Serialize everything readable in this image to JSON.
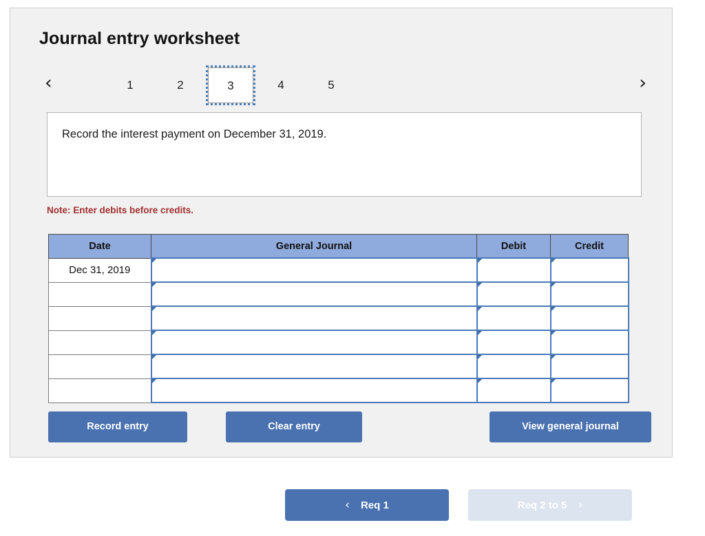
{
  "worksheet": {
    "title": "Journal entry worksheet",
    "prev_icon": "chevron-left-icon",
    "next_icon": "chevron-right-icon",
    "tabs": [
      {
        "label": "1",
        "active": false
      },
      {
        "label": "2",
        "active": false
      },
      {
        "label": "3",
        "active": true
      },
      {
        "label": "4",
        "active": false
      },
      {
        "label": "5",
        "active": false
      }
    ],
    "description": "Record the interest payment on December 31, 2019.",
    "note": "Note: Enter debits before credits."
  },
  "journal": {
    "headers": {
      "date": "Date",
      "general_journal": "General Journal",
      "debit": "Debit",
      "credit": "Credit"
    },
    "rows": [
      {
        "date": "Dec 31, 2019",
        "general_journal": "",
        "debit": "",
        "credit": ""
      },
      {
        "date": "",
        "general_journal": "",
        "debit": "",
        "credit": ""
      },
      {
        "date": "",
        "general_journal": "",
        "debit": "",
        "credit": ""
      },
      {
        "date": "",
        "general_journal": "",
        "debit": "",
        "credit": ""
      },
      {
        "date": "",
        "general_journal": "",
        "debit": "",
        "credit": ""
      },
      {
        "date": "",
        "general_journal": "",
        "debit": "",
        "credit": ""
      }
    ]
  },
  "actions": {
    "record_entry": "Record entry",
    "clear_entry": "Clear entry",
    "view_general_journal": "View general journal"
  },
  "req_nav": {
    "prev_label": "Req 1",
    "prev_icon": "chevron-left-icon",
    "next_label": "Req 2 to 5",
    "next_icon": "chevron-right-icon"
  },
  "colors": {
    "panel_bg": "#f1f1f1",
    "table_header_blue": "#8faadc",
    "button_blue": "#4a72b0",
    "disabled_button_blue": "#dce4f0",
    "note_red": "#a33030",
    "input_border_blue": "#4a79b8"
  }
}
